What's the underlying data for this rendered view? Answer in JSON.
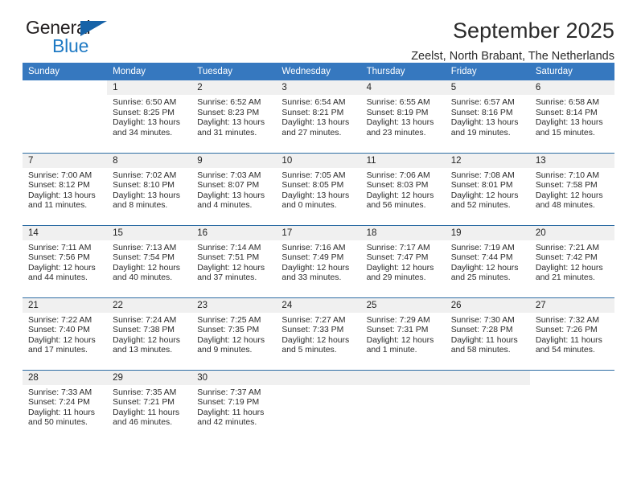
{
  "brand": {
    "name_part1": "General",
    "name_part2": "Blue",
    "triangle_color": "#1763a8",
    "blue_color": "#1f7ac4"
  },
  "header": {
    "title": "September 2025",
    "location": "Zeelst, North Brabant, The Netherlands"
  },
  "theme": {
    "header_row_bg": "#3678bf",
    "row_divider": "#2e6da4",
    "daynum_bg": "#f0f0f0"
  },
  "weekday_headers": [
    "Sunday",
    "Monday",
    "Tuesday",
    "Wednesday",
    "Thursday",
    "Friday",
    "Saturday"
  ],
  "weeks": [
    [
      {
        "day": "",
        "sunrise": "",
        "sunset": "",
        "daylight1": "",
        "daylight2": "",
        "blank": true,
        "void": true
      },
      {
        "day": "1",
        "sunrise": "Sunrise: 6:50 AM",
        "sunset": "Sunset: 8:25 PM",
        "daylight1": "Daylight: 13 hours",
        "daylight2": "and 34 minutes."
      },
      {
        "day": "2",
        "sunrise": "Sunrise: 6:52 AM",
        "sunset": "Sunset: 8:23 PM",
        "daylight1": "Daylight: 13 hours",
        "daylight2": "and 31 minutes."
      },
      {
        "day": "3",
        "sunrise": "Sunrise: 6:54 AM",
        "sunset": "Sunset: 8:21 PM",
        "daylight1": "Daylight: 13 hours",
        "daylight2": "and 27 minutes."
      },
      {
        "day": "4",
        "sunrise": "Sunrise: 6:55 AM",
        "sunset": "Sunset: 8:19 PM",
        "daylight1": "Daylight: 13 hours",
        "daylight2": "and 23 minutes."
      },
      {
        "day": "5",
        "sunrise": "Sunrise: 6:57 AM",
        "sunset": "Sunset: 8:16 PM",
        "daylight1": "Daylight: 13 hours",
        "daylight2": "and 19 minutes."
      },
      {
        "day": "6",
        "sunrise": "Sunrise: 6:58 AM",
        "sunset": "Sunset: 8:14 PM",
        "daylight1": "Daylight: 13 hours",
        "daylight2": "and 15 minutes."
      }
    ],
    [
      {
        "day": "7",
        "sunrise": "Sunrise: 7:00 AM",
        "sunset": "Sunset: 8:12 PM",
        "daylight1": "Daylight: 13 hours",
        "daylight2": "and 11 minutes."
      },
      {
        "day": "8",
        "sunrise": "Sunrise: 7:02 AM",
        "sunset": "Sunset: 8:10 PM",
        "daylight1": "Daylight: 13 hours",
        "daylight2": "and 8 minutes."
      },
      {
        "day": "9",
        "sunrise": "Sunrise: 7:03 AM",
        "sunset": "Sunset: 8:07 PM",
        "daylight1": "Daylight: 13 hours",
        "daylight2": "and 4 minutes."
      },
      {
        "day": "10",
        "sunrise": "Sunrise: 7:05 AM",
        "sunset": "Sunset: 8:05 PM",
        "daylight1": "Daylight: 13 hours",
        "daylight2": "and 0 minutes."
      },
      {
        "day": "11",
        "sunrise": "Sunrise: 7:06 AM",
        "sunset": "Sunset: 8:03 PM",
        "daylight1": "Daylight: 12 hours",
        "daylight2": "and 56 minutes."
      },
      {
        "day": "12",
        "sunrise": "Sunrise: 7:08 AM",
        "sunset": "Sunset: 8:01 PM",
        "daylight1": "Daylight: 12 hours",
        "daylight2": "and 52 minutes."
      },
      {
        "day": "13",
        "sunrise": "Sunrise: 7:10 AM",
        "sunset": "Sunset: 7:58 PM",
        "daylight1": "Daylight: 12 hours",
        "daylight2": "and 48 minutes."
      }
    ],
    [
      {
        "day": "14",
        "sunrise": "Sunrise: 7:11 AM",
        "sunset": "Sunset: 7:56 PM",
        "daylight1": "Daylight: 12 hours",
        "daylight2": "and 44 minutes."
      },
      {
        "day": "15",
        "sunrise": "Sunrise: 7:13 AM",
        "sunset": "Sunset: 7:54 PM",
        "daylight1": "Daylight: 12 hours",
        "daylight2": "and 40 minutes."
      },
      {
        "day": "16",
        "sunrise": "Sunrise: 7:14 AM",
        "sunset": "Sunset: 7:51 PM",
        "daylight1": "Daylight: 12 hours",
        "daylight2": "and 37 minutes."
      },
      {
        "day": "17",
        "sunrise": "Sunrise: 7:16 AM",
        "sunset": "Sunset: 7:49 PM",
        "daylight1": "Daylight: 12 hours",
        "daylight2": "and 33 minutes."
      },
      {
        "day": "18",
        "sunrise": "Sunrise: 7:17 AM",
        "sunset": "Sunset: 7:47 PM",
        "daylight1": "Daylight: 12 hours",
        "daylight2": "and 29 minutes."
      },
      {
        "day": "19",
        "sunrise": "Sunrise: 7:19 AM",
        "sunset": "Sunset: 7:44 PM",
        "daylight1": "Daylight: 12 hours",
        "daylight2": "and 25 minutes."
      },
      {
        "day": "20",
        "sunrise": "Sunrise: 7:21 AM",
        "sunset": "Sunset: 7:42 PM",
        "daylight1": "Daylight: 12 hours",
        "daylight2": "and 21 minutes."
      }
    ],
    [
      {
        "day": "21",
        "sunrise": "Sunrise: 7:22 AM",
        "sunset": "Sunset: 7:40 PM",
        "daylight1": "Daylight: 12 hours",
        "daylight2": "and 17 minutes."
      },
      {
        "day": "22",
        "sunrise": "Sunrise: 7:24 AM",
        "sunset": "Sunset: 7:38 PM",
        "daylight1": "Daylight: 12 hours",
        "daylight2": "and 13 minutes."
      },
      {
        "day": "23",
        "sunrise": "Sunrise: 7:25 AM",
        "sunset": "Sunset: 7:35 PM",
        "daylight1": "Daylight: 12 hours",
        "daylight2": "and 9 minutes."
      },
      {
        "day": "24",
        "sunrise": "Sunrise: 7:27 AM",
        "sunset": "Sunset: 7:33 PM",
        "daylight1": "Daylight: 12 hours",
        "daylight2": "and 5 minutes."
      },
      {
        "day": "25",
        "sunrise": "Sunrise: 7:29 AM",
        "sunset": "Sunset: 7:31 PM",
        "daylight1": "Daylight: 12 hours",
        "daylight2": "and 1 minute."
      },
      {
        "day": "26",
        "sunrise": "Sunrise: 7:30 AM",
        "sunset": "Sunset: 7:28 PM",
        "daylight1": "Daylight: 11 hours",
        "daylight2": "and 58 minutes."
      },
      {
        "day": "27",
        "sunrise": "Sunrise: 7:32 AM",
        "sunset": "Sunset: 7:26 PM",
        "daylight1": "Daylight: 11 hours",
        "daylight2": "and 54 minutes."
      }
    ],
    [
      {
        "day": "28",
        "sunrise": "Sunrise: 7:33 AM",
        "sunset": "Sunset: 7:24 PM",
        "daylight1": "Daylight: 11 hours",
        "daylight2": "and 50 minutes."
      },
      {
        "day": "29",
        "sunrise": "Sunrise: 7:35 AM",
        "sunset": "Sunset: 7:21 PM",
        "daylight1": "Daylight: 11 hours",
        "daylight2": "and 46 minutes."
      },
      {
        "day": "30",
        "sunrise": "Sunrise: 7:37 AM",
        "sunset": "Sunset: 7:19 PM",
        "daylight1": "Daylight: 11 hours",
        "daylight2": "and 42 minutes."
      },
      {
        "day": "",
        "sunrise": "",
        "sunset": "",
        "daylight1": "",
        "daylight2": "",
        "blank": true
      },
      {
        "day": "",
        "sunrise": "",
        "sunset": "",
        "daylight1": "",
        "daylight2": "",
        "blank": true
      },
      {
        "day": "",
        "sunrise": "",
        "sunset": "",
        "daylight1": "",
        "daylight2": "",
        "blank": true
      },
      {
        "day": "",
        "sunrise": "",
        "sunset": "",
        "daylight1": "",
        "daylight2": "",
        "blank": true,
        "void": true
      }
    ]
  ]
}
